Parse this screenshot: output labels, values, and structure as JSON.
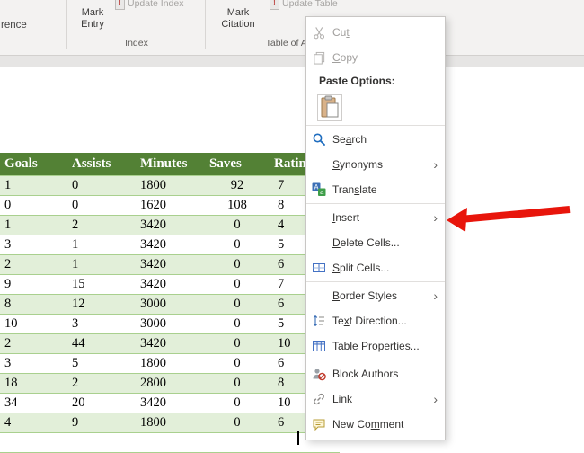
{
  "ribbon": {
    "cropped_button_label": "rence",
    "mark_entry_label": "Mark Entry",
    "update_index_label": "Update Index",
    "index_group_label": "Index",
    "mark_citation_label": "Mark Citation",
    "update_table_label": "Update Table",
    "table_of_authorities_group_label": "Table of Authorities"
  },
  "document_table": {
    "headers": [
      "Goals",
      "Assists",
      "Minutes",
      "Saves",
      "Rating"
    ],
    "rows": [
      [
        "1",
        "0",
        "1800",
        "92",
        "7"
      ],
      [
        "0",
        "0",
        "1620",
        "108",
        "8"
      ],
      [
        "1",
        "2",
        "3420",
        "0",
        "4"
      ],
      [
        "3",
        "1",
        "3420",
        "0",
        "5"
      ],
      [
        "2",
        "1",
        "3420",
        "0",
        "6"
      ],
      [
        "9",
        "15",
        "3420",
        "0",
        "7"
      ],
      [
        "8",
        "12",
        "3000",
        "0",
        "6"
      ],
      [
        "10",
        "3",
        "3000",
        "0",
        "5"
      ],
      [
        "2",
        "44",
        "3420",
        "0",
        "10"
      ],
      [
        "3",
        "5",
        "1800",
        "0",
        "6"
      ],
      [
        "18",
        "2",
        "2800",
        "0",
        "8"
      ],
      [
        "34",
        "20",
        "3420",
        "0",
        "10"
      ],
      [
        "4",
        "9",
        "1800",
        "0",
        "6"
      ],
      [
        "",
        "",
        "",
        "",
        ""
      ]
    ],
    "colors": {
      "header_bg": "#538135",
      "band_bg": "#e2efd9",
      "border": "#a9d08e"
    }
  },
  "context_menu": {
    "items": [
      {
        "type": "item",
        "id": "cut",
        "label": "Cut",
        "accel_index": 2,
        "icon": "cut-icon",
        "disabled": true
      },
      {
        "type": "item",
        "id": "copy",
        "label": "Copy",
        "accel_index": 0,
        "icon": "copy-icon",
        "disabled": true
      },
      {
        "type": "caption",
        "id": "paste-options",
        "label": "Paste Options:"
      },
      {
        "type": "paste-row",
        "id": "paste",
        "icon": "paste-icon"
      },
      {
        "type": "separator"
      },
      {
        "type": "item",
        "id": "search",
        "label": "Search",
        "accel_index": 2,
        "icon": "search-icon"
      },
      {
        "type": "item",
        "id": "synonyms",
        "label": "Synonyms",
        "accel_index": 0,
        "submenu": true
      },
      {
        "type": "item",
        "id": "translate",
        "label": "Translate",
        "accel_index": 4,
        "icon": "translate-icon"
      },
      {
        "type": "separator"
      },
      {
        "type": "item",
        "id": "insert",
        "label": "Insert",
        "accel_index": 0,
        "submenu": true,
        "pointed_by_arrow": true
      },
      {
        "type": "item",
        "id": "delete-cells",
        "label": "Delete Cells...",
        "accel_index": 0
      },
      {
        "type": "item",
        "id": "split-cells",
        "label": "Split Cells...",
        "accel_index": 0,
        "icon": "split-cells-icon"
      },
      {
        "type": "separator"
      },
      {
        "type": "item",
        "id": "border-styles",
        "label": "Border Styles",
        "accel_index": 0,
        "submenu": true
      },
      {
        "type": "item",
        "id": "text-direction",
        "label": "Text Direction...",
        "accel_index": 2,
        "icon": "text-direction-icon"
      },
      {
        "type": "item",
        "id": "table-properties",
        "label": "Table Properties...",
        "accel_index": 7,
        "icon": "table-properties-icon"
      },
      {
        "type": "separator"
      },
      {
        "type": "item",
        "id": "block-authors",
        "label": "Block Authors",
        "accel_index": -1,
        "icon": "block-authors-icon"
      },
      {
        "type": "item",
        "id": "link",
        "label": "Link",
        "accel_index": -1,
        "icon": "link-icon",
        "submenu": true
      },
      {
        "type": "item",
        "id": "new-comment",
        "label": "New Comment",
        "accel_index": 6,
        "icon": "new-comment-icon"
      }
    ]
  },
  "annotation": {
    "arrow_color": "#e8150b"
  }
}
